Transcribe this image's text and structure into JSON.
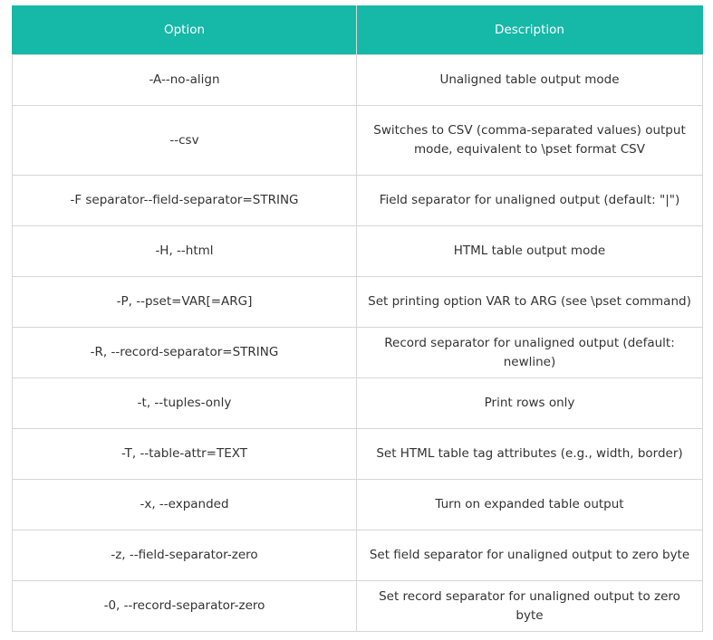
{
  "colors": {
    "header_bg": "#16b8a8",
    "header_text": "#ffffff",
    "border": "#d6d6d6",
    "body_text": "#333333"
  },
  "table": {
    "headers": [
      "Option",
      "Description"
    ],
    "rows": [
      [
        "-A--no-align",
        "Unaligned table output mode"
      ],
      [
        "--csv",
        "Switches to CSV (comma-separated values) output mode, equivalent to \\pset format CSV"
      ],
      [
        "-F separator--field-separator=STRING",
        "Field separator for unaligned output (default: \"|\")"
      ],
      [
        "-H, --html",
        "HTML table output mode"
      ],
      [
        "-P, --pset=VAR[=ARG]",
        "Set printing option VAR to ARG (see \\pset command)"
      ],
      [
        "-R, --record-separator=STRING",
        "Record separator for unaligned output (default: newline)"
      ],
      [
        "-t, --tuples-only",
        "Print rows only"
      ],
      [
        "-T, --table-attr=TEXT",
        "Set HTML table tag attributes (e.g., width, border)"
      ],
      [
        "-x, --expanded",
        "Turn on expanded table output"
      ],
      [
        "-z, --field-separator-zero",
        "Set field separator for unaligned output to zero byte"
      ],
      [
        "-0, --record-separator-zero",
        "Set record separator for unaligned output to zero byte"
      ]
    ]
  }
}
